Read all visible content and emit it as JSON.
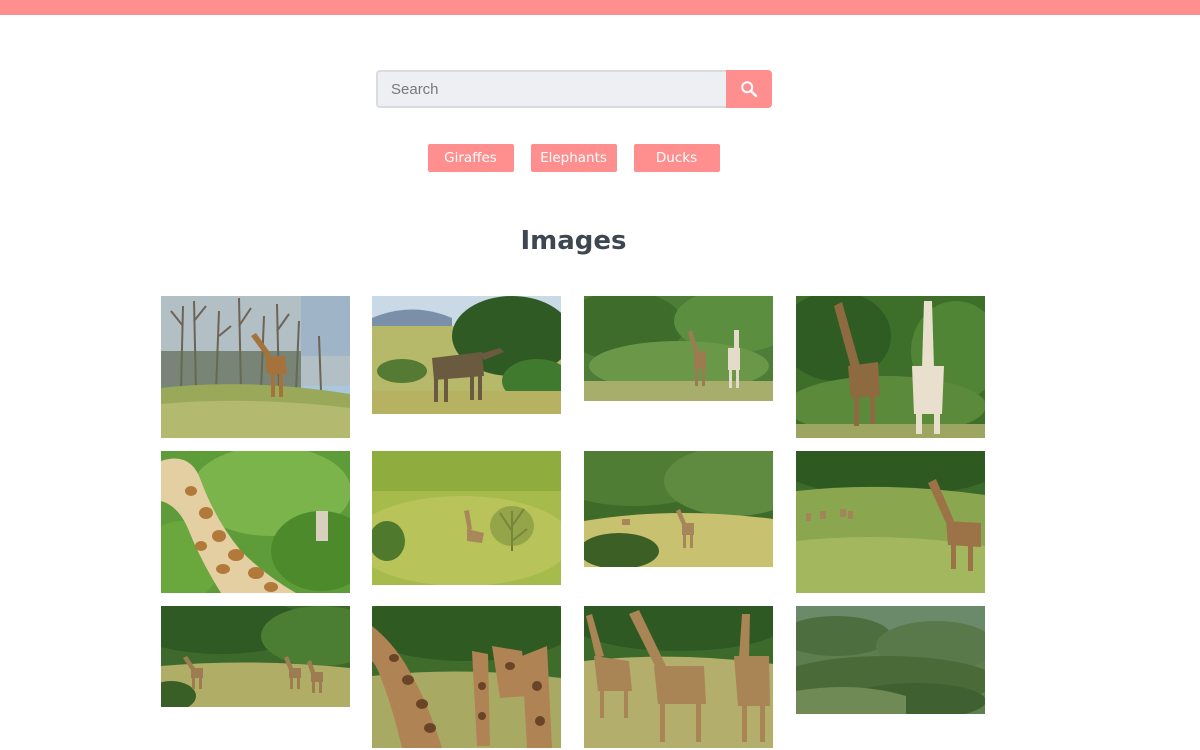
{
  "search": {
    "placeholder": "Search",
    "value": "",
    "icon": "search-icon",
    "accent": "#ff8f8f"
  },
  "tags": [
    {
      "label": "Giraffes"
    },
    {
      "label": "Elephants"
    },
    {
      "label": "Ducks"
    }
  ],
  "gallery": {
    "title": "Images",
    "images": [
      {
        "scene": "giraffe in open park with bare trees and blue sky"
      },
      {
        "scene": "giraffe browsing beside green bushes with hills"
      },
      {
        "scene": "two giraffes in green bushland"
      },
      {
        "scene": "close view of two giraffes among bushes"
      },
      {
        "scene": "close-up of giraffe neck among leaves"
      },
      {
        "scene": "young giraffe lying in tall grass"
      },
      {
        "scene": "giraffes in a grassy valley"
      },
      {
        "scene": "giraffe near antelopes in grassland"
      },
      {
        "scene": "three giraffes in savanna with bushes"
      },
      {
        "scene": "herd of giraffes up close"
      },
      {
        "scene": "three giraffes in tall grass"
      },
      {
        "scene": "hillside bushland with distant giraffes"
      }
    ]
  }
}
